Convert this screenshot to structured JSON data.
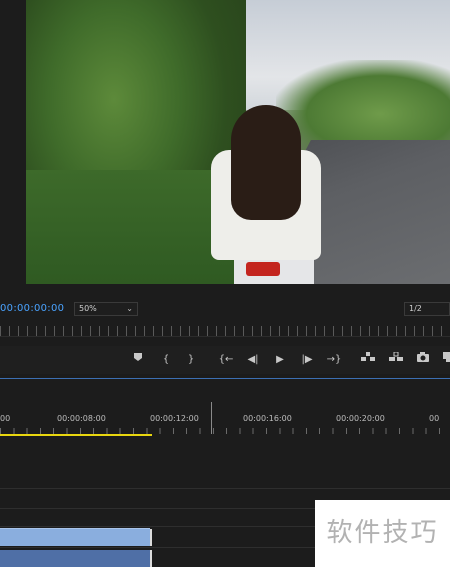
{
  "program_monitor": {
    "timecode": "00:00:00:00",
    "zoom_level": "50%",
    "resolution": "1/2"
  },
  "transport_controls": [
    {
      "name": "add-marker-icon",
      "glyph": "⬤"
    },
    {
      "name": "mark-in-icon",
      "glyph": "{"
    },
    {
      "name": "mark-out-icon",
      "glyph": "}"
    },
    {
      "name": "go-to-in-icon",
      "glyph": "{←"
    },
    {
      "name": "step-back-icon",
      "glyph": "◀|"
    },
    {
      "name": "play-icon",
      "glyph": "▶"
    },
    {
      "name": "step-forward-icon",
      "glyph": "|▶"
    },
    {
      "name": "go-to-out-icon",
      "glyph": "→}"
    },
    {
      "name": "lift-icon",
      "glyph": "⇡"
    },
    {
      "name": "extract-icon",
      "glyph": "⇞"
    },
    {
      "name": "export-frame-icon",
      "glyph": "◙"
    },
    {
      "name": "button-editor-icon",
      "glyph": "▣"
    }
  ],
  "timeline": {
    "ruler_labels": [
      "00",
      "00:00:08:00",
      "00:00:12:00",
      "00:00:16:00",
      "00:00:20:00",
      "00"
    ]
  },
  "watermark": {
    "text": "软件技巧"
  }
}
